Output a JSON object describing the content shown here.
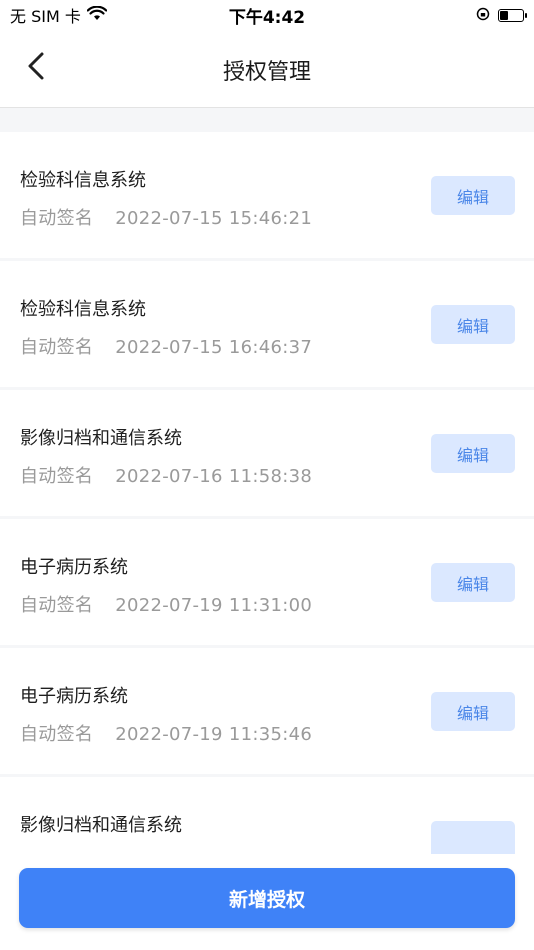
{
  "status": {
    "carrier": "无 SIM 卡",
    "time": "下午4:42",
    "battery_level": 0.35
  },
  "nav": {
    "title": "授权管理",
    "back_icon": "chevron-left-icon"
  },
  "records": [
    {
      "system": "检验科信息系统",
      "type": "自动签名",
      "datetime": "2022-07-15 15:46:21",
      "action": "编辑"
    },
    {
      "system": "检验科信息系统",
      "type": "自动签名",
      "datetime": "2022-07-15 16:46:37",
      "action": "编辑"
    },
    {
      "system": "影像归档和通信系统",
      "type": "自动签名",
      "datetime": "2022-07-16 11:58:38",
      "action": "编辑"
    },
    {
      "system": "电子病历系统",
      "type": "自动签名",
      "datetime": "2022-07-19 11:31:00",
      "action": "编辑"
    },
    {
      "system": "电子病历系统",
      "type": "自动签名",
      "datetime": "2022-07-19 11:35:46",
      "action": "编辑"
    },
    {
      "system": "影像归档和通信系统",
      "type": "",
      "datetime": "",
      "action": ""
    }
  ],
  "footer": {
    "add_label": "新增授权"
  },
  "colors": {
    "primary": "#3f82f7",
    "edit_bg": "#dbe8ff",
    "edit_text": "#4a86e8",
    "muted_text": "#9a9a9a"
  }
}
